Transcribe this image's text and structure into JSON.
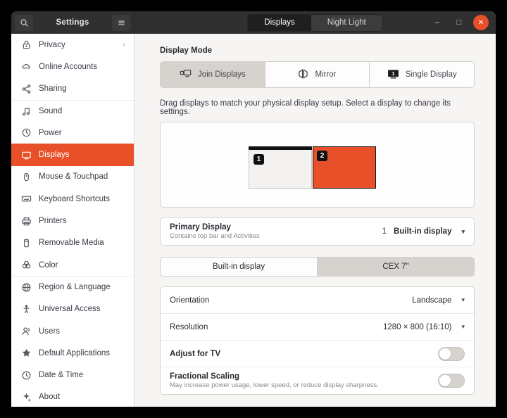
{
  "window": {
    "title": "Settings",
    "search_icon": "search-icon",
    "menu_icon": "hamburger-menu-icon",
    "tabs": [
      {
        "label": "Displays",
        "active": true
      },
      {
        "label": "Night Light",
        "active": false
      }
    ],
    "controls": {
      "minimize": "–",
      "maximize": "□",
      "close": "✕"
    }
  },
  "sidebar": {
    "items": [
      {
        "label": "Privacy",
        "icon": "lock-icon",
        "chevron": "›",
        "selected": false,
        "sep_above": false
      },
      {
        "label": "Online Accounts",
        "icon": "cloud-icon",
        "chevron": "",
        "selected": false,
        "sep_above": false
      },
      {
        "label": "Sharing",
        "icon": "share-nodes-icon",
        "chevron": "",
        "selected": false,
        "sep_above": false
      },
      {
        "label": "Sound",
        "icon": "music-note-icon",
        "chevron": "",
        "selected": false,
        "sep_above": true
      },
      {
        "label": "Power",
        "icon": "power-icon",
        "chevron": "",
        "selected": false,
        "sep_above": false
      },
      {
        "label": "Displays",
        "icon": "display-icon",
        "chevron": "",
        "selected": true,
        "sep_above": false
      },
      {
        "label": "Mouse & Touchpad",
        "icon": "mouse-icon",
        "chevron": "",
        "selected": false,
        "sep_above": false
      },
      {
        "label": "Keyboard Shortcuts",
        "icon": "keyboard-icon",
        "chevron": "",
        "selected": false,
        "sep_above": false
      },
      {
        "label": "Printers",
        "icon": "printer-icon",
        "chevron": "",
        "selected": false,
        "sep_above": false
      },
      {
        "label": "Removable Media",
        "icon": "removable-media-icon",
        "chevron": "",
        "selected": false,
        "sep_above": false
      },
      {
        "label": "Color",
        "icon": "color-icon",
        "chevron": "",
        "selected": false,
        "sep_above": false
      },
      {
        "label": "Region & Language",
        "icon": "globe-icon",
        "chevron": "",
        "selected": false,
        "sep_above": true
      },
      {
        "label": "Universal Access",
        "icon": "accessibility-icon",
        "chevron": "",
        "selected": false,
        "sep_above": false
      },
      {
        "label": "Users",
        "icon": "users-icon",
        "chevron": "",
        "selected": false,
        "sep_above": false
      },
      {
        "label": "Default Applications",
        "icon": "star-icon",
        "chevron": "",
        "selected": false,
        "sep_above": false
      },
      {
        "label": "Date & Time",
        "icon": "clock-icon",
        "chevron": "",
        "selected": false,
        "sep_above": false
      },
      {
        "label": "About",
        "icon": "info-icon",
        "chevron": "",
        "selected": false,
        "sep_above": false
      }
    ]
  },
  "main": {
    "display_mode": {
      "title": "Display Mode",
      "options": [
        {
          "label": "Join Displays",
          "icon": "join-displays-icon",
          "active": true
        },
        {
          "label": "Mirror",
          "icon": "mirror-icon",
          "active": false
        },
        {
          "label": "Single Display",
          "icon": "single-display-icon",
          "active": false
        }
      ]
    },
    "arrangement": {
      "hint": "Drag displays to match your physical display setup. Select a display to change its settings.",
      "monitors": [
        {
          "number": "1",
          "selected": false,
          "has_top_bar": true
        },
        {
          "number": "2",
          "selected": true,
          "has_top_bar": false
        }
      ]
    },
    "primary_display": {
      "title": "Primary Display",
      "subtitle": "Contains top bar and Activities",
      "index": "1",
      "value": "Built-in display",
      "caret": "▾"
    },
    "display_tabs": [
      {
        "label": "Built-in display",
        "active": false
      },
      {
        "label": "CEX 7\"",
        "active": true
      }
    ],
    "settings": [
      {
        "kind": "dropdown",
        "title": "Orientation",
        "subtitle": "",
        "value": "Landscape",
        "caret": "▾"
      },
      {
        "kind": "dropdown",
        "title": "Resolution",
        "subtitle": "",
        "value": "1280 × 800 (16:10)",
        "caret": "▾"
      },
      {
        "kind": "toggle",
        "title": "Adjust for TV",
        "subtitle": "",
        "on": false
      },
      {
        "kind": "toggle",
        "title": "Fractional Scaling",
        "subtitle": "May increase power usage, lower speed, or reduce display sharpness.",
        "on": false
      }
    ]
  },
  "colors": {
    "accent": "#e8502a",
    "titlebar": "#303030",
    "content_bg": "#f6f5f4",
    "card_bg": "#ffffff"
  }
}
